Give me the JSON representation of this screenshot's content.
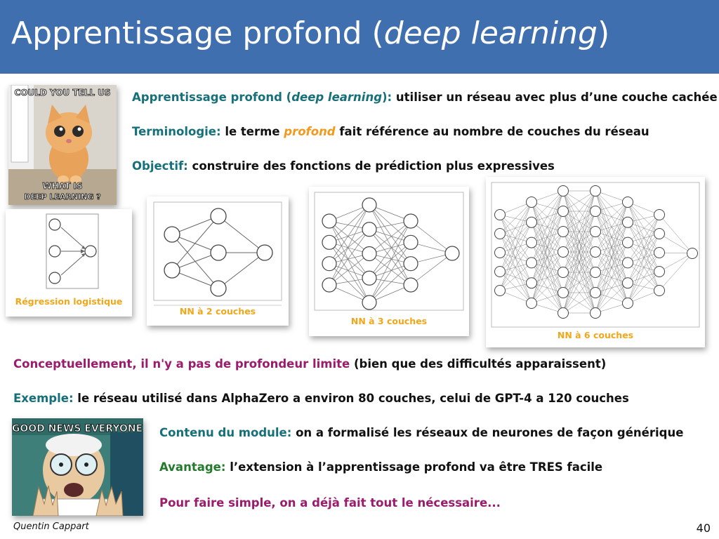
{
  "title": {
    "prefix": "Apprentissage profond (",
    "italic": "deep learning",
    "suffix": ")"
  },
  "bullets_top": {
    "def_label_1": "Apprentissage profond (",
    "def_label_italic": "deep learning",
    "def_label_2": "):",
    "def_text": " utiliser un réseau avec plus d’une couche cachée",
    "term_label": "Terminologie:",
    "term_text_1": " le terme ",
    "term_highlight": "profond",
    "term_text_2": " fait référence au nombre de couches du réseau",
    "obj_label": "Objectif:",
    "obj_text": " construire des fonctions de prédiction plus expressives"
  },
  "meme_cat": {
    "top_text": "COULD YOU TELL US",
    "bottom_text_1": "WHAT IS",
    "bottom_text_2": "DEEP LEARNING ?"
  },
  "diagrams": {
    "logistic": "Régression logistique",
    "nn2": "NN à 2 couches",
    "nn3": "NN à 3 couches",
    "nn6": "NN à 6 couches"
  },
  "bullets_bottom": {
    "concept_label": "Conceptuellement, il n'y a pas de profondeur limite",
    "concept_text": " (bien que des difficultés apparaissent)",
    "example_label": "Exemple:",
    "example_text": " le réseau utilisé dans AlphaZero a environ 80 couches, celui de GPT-4 a 120 couches",
    "module_label": "Contenu du module:",
    "module_text": " on a formalisé les réseaux de neurones de façon générique",
    "adv_label": "Avantage:",
    "adv_text": " l’extension à l’apprentissage profond va être TRES facile",
    "simple_text": "Pour faire simple, on a déjà fait tout le nécessaire..."
  },
  "meme_farnsworth": {
    "top_text": "GOOD NEWS EVERYONE"
  },
  "footer": {
    "author": "Quentin Cappart",
    "page": "40"
  },
  "colors": {
    "header": "#3f6fae",
    "teal": "#16707a",
    "orange": "#f19a1e",
    "purple": "#9b1b6d",
    "green": "#237a2b"
  }
}
